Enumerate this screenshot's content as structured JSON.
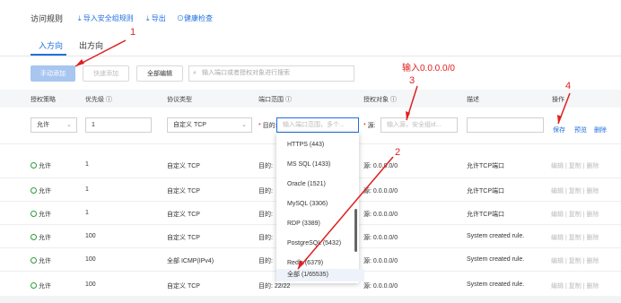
{
  "header": {
    "title": "访问规则",
    "import_label": "导入安全组规则",
    "export_label": "导出",
    "health_label": "健康检查"
  },
  "tabs": [
    {
      "label": "入方向"
    },
    {
      "label": "出方向"
    }
  ],
  "toolbar": {
    "manual_add": "手动添加",
    "quick_add": "快速添加",
    "edit_all": "全部编辑",
    "search_placeholder": "输入端口或者授权对象进行搜索"
  },
  "columns": {
    "policy": "授权策略",
    "priority": "优先级 ⓘ",
    "protocol": "协议类型",
    "port": "端口范围 ⓘ",
    "target": "授权对象 ⓘ",
    "desc": "描述",
    "ops": "操作"
  },
  "edit_row": {
    "policy": "允许",
    "priority": "1",
    "protocol": "自定义 TCP",
    "port_prefix": "目的:",
    "port_placeholder": "输入端口范围，多个...",
    "target_prefix": "源:",
    "target_placeholder": "输入源，安全组id...",
    "save": "保存",
    "preview": "预览",
    "delete": "删除"
  },
  "dropdown": {
    "items": [
      "HTTPS (443)",
      "MS SQL (1433)",
      "Oracle (1521)",
      "MySQL (3306)",
      "RDP (3389)",
      "PostgreSQL (5432)",
      "Redis (6379)",
      "全部 (1/65535)"
    ]
  },
  "rows": [
    {
      "policy": "允许",
      "priority": "1",
      "protocol": "自定义 TCP",
      "port": "目的:",
      "target": "源: 0.0.0.0/0",
      "desc": "允许TCP端口"
    },
    {
      "policy": "允许",
      "priority": "1",
      "protocol": "自定义 TCP",
      "port": "目的:",
      "target": "源: 0.0.0.0/0",
      "desc": "允许TCP端口"
    },
    {
      "policy": "允许",
      "priority": "1",
      "protocol": "自定义 TCP",
      "port": "目的:",
      "target": "源: 0.0.0.0/0",
      "desc": "允许TCP端口"
    },
    {
      "policy": "允许",
      "priority": "100",
      "protocol": "自定义 TCP",
      "port": "目的:",
      "target": "源: 0.0.0.0/0",
      "desc": "System created rule."
    },
    {
      "policy": "允许",
      "priority": "100",
      "protocol": "全部 ICMP(IPv4)",
      "port": "目的:",
      "target": "源: 0.0.0.0/0",
      "desc": "System created rule."
    },
    {
      "policy": "允许",
      "priority": "100",
      "protocol": "自定义 TCP",
      "port": "目的: 22/22",
      "target": "源: 0.0.0.0/0",
      "desc": "System created rule."
    }
  ],
  "row_ops": {
    "edit": "编辑",
    "copy": "复制",
    "delete": "删除"
  },
  "annotations": {
    "n1": "1",
    "n2": "2",
    "n3": "3",
    "n4": "4",
    "hint": "输入0.0.0.0/0"
  },
  "colors": {
    "accent": "#1f6fe0",
    "annotation": "#e02020",
    "success": "#2a9d3a"
  }
}
